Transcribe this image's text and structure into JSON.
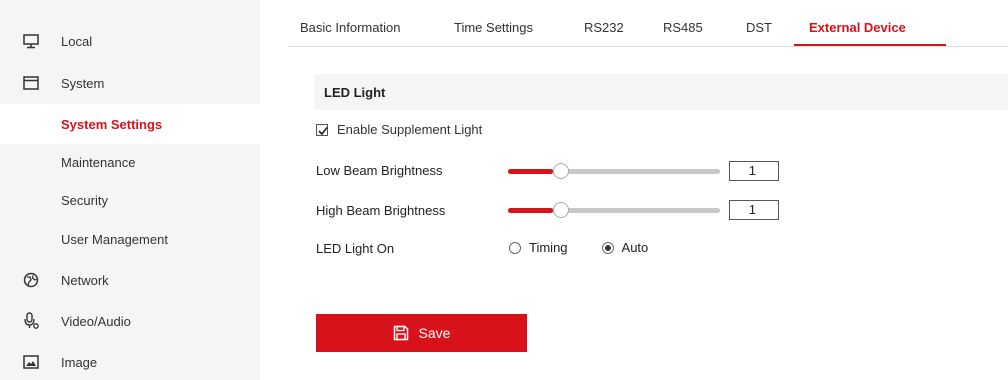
{
  "sidebar": {
    "items": [
      {
        "label": "Local",
        "icon": "monitor-icon"
      },
      {
        "label": "System",
        "icon": "window-icon"
      },
      {
        "label": "System Settings",
        "active": true
      },
      {
        "label": "Maintenance"
      },
      {
        "label": "Security"
      },
      {
        "label": "User Management"
      },
      {
        "label": "Network",
        "icon": "globe-icon"
      },
      {
        "label": "Video/Audio",
        "icon": "microphone-icon"
      },
      {
        "label": "Image",
        "icon": "image-icon"
      }
    ]
  },
  "tabs": [
    {
      "label": "Basic Information"
    },
    {
      "label": "Time Settings"
    },
    {
      "label": "RS232"
    },
    {
      "label": "RS485"
    },
    {
      "label": "DST"
    },
    {
      "label": "External Device",
      "active": true
    }
  ],
  "section": {
    "title": "LED Light",
    "enable_label": "Enable Supplement Light",
    "enable_checked": true,
    "low_beam": {
      "label": "Low Beam Brightness",
      "value": "1",
      "fraction": 0.12
    },
    "high_beam": {
      "label": "High Beam Brightness",
      "value": "1",
      "fraction": 0.12
    },
    "led_on": {
      "label": "LED Light On",
      "options": [
        {
          "label": "Timing",
          "selected": false
        },
        {
          "label": "Auto",
          "selected": true
        }
      ]
    }
  },
  "save_label": "Save",
  "colors": {
    "accent": "#d7121b",
    "sidebar_bg": "#f5f5f5",
    "track": "#c8c8c8"
  }
}
